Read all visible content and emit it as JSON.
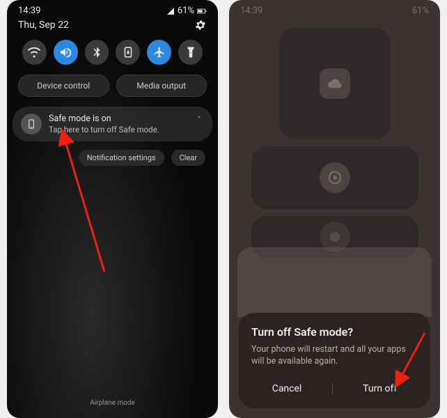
{
  "left": {
    "time": "14:39",
    "battery_pct": "61%",
    "date": "Thu, Sep 22",
    "qs": {
      "wifi": "wifi-icon",
      "sound": "sound-icon",
      "bluetooth": "bluetooth-icon",
      "lock_rotate": "rotation-lock-icon",
      "airplane": "airplane-icon",
      "flashlight": "flashlight-icon"
    },
    "pills": {
      "device_control": "Device control",
      "media_output": "Media output"
    },
    "notification": {
      "title": "Safe mode is on",
      "subtitle": "Tap here to turn off Safe mode."
    },
    "actions": {
      "settings": "Notification settings",
      "clear": "Clear"
    },
    "footer": "Airplane mode"
  },
  "right": {
    "time": "14:39",
    "battery_pct": "61%",
    "dialog": {
      "title": "Turn off Safe mode?",
      "body": "Your phone will restart and all your apps will be available again.",
      "cancel": "Cancel",
      "confirm": "Turn off"
    }
  }
}
